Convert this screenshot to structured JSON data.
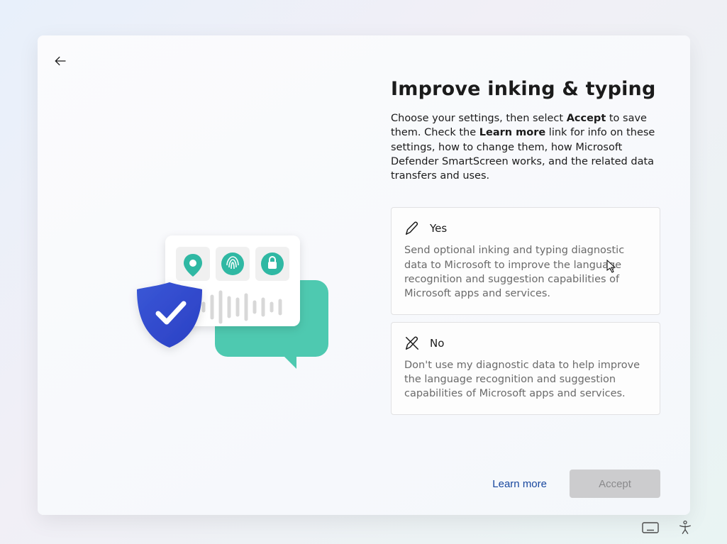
{
  "title": "Improve inking & typing",
  "subtitle_pre": "Choose your settings, then select ",
  "subtitle_bold1": "Accept",
  "subtitle_mid": " to save them. Check the ",
  "subtitle_bold2": "Learn more",
  "subtitle_post": " link for info on these settings, how to change them, how Microsoft Defender SmartScreen works, and the related data transfers and uses.",
  "options": {
    "yes": {
      "title": "Yes",
      "desc": "Send optional inking and typing diagnostic data to Microsoft to improve the language recognition and suggestion capabilities of Microsoft apps and services."
    },
    "no": {
      "title": "No",
      "desc": "Don't use my diagnostic data to help improve the language recognition and suggestion capabilities of Microsoft apps and services."
    }
  },
  "buttons": {
    "learn_more": "Learn more",
    "accept": "Accept"
  }
}
